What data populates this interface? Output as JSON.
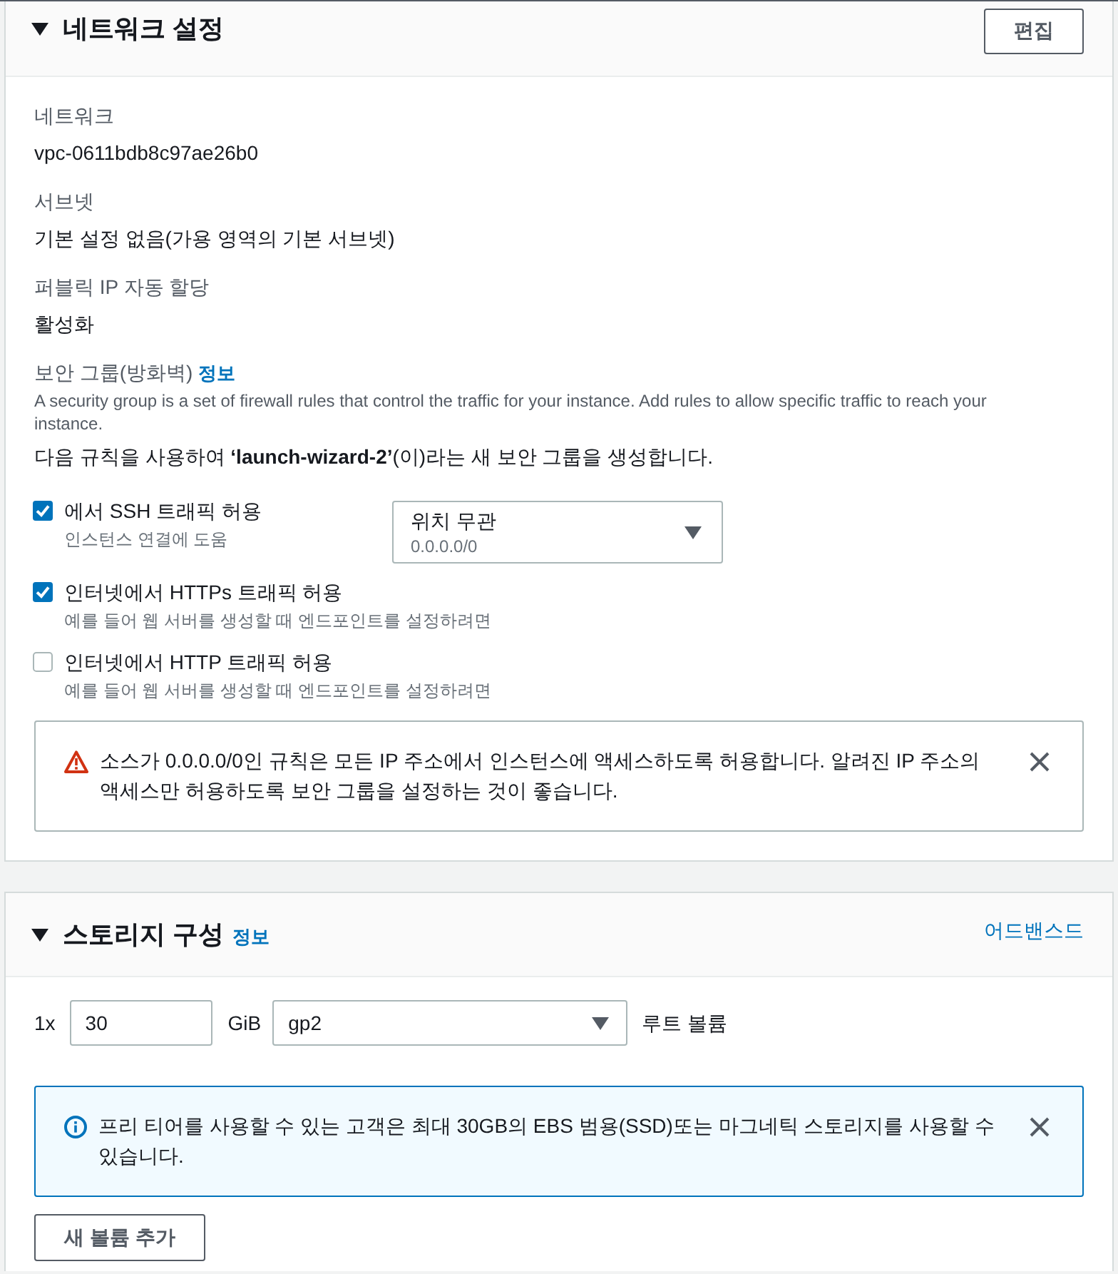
{
  "network_section": {
    "title": "네트워크 설정",
    "expanded": true,
    "edit_button": "편집",
    "fields": [
      {
        "label": "네트워크",
        "value": "vpc-0611bdb8c97ae26b0"
      },
      {
        "label": "서브넷",
        "value": "기본 설정 없음(가용 영역의 기본 서브넷)"
      },
      {
        "label": "퍼블릭 IP 자동 할당",
        "value": "활성화"
      }
    ],
    "security_group": {
      "label": "보안 그룹(방화벽)",
      "info_link": "정보",
      "description": "A security group is a set of firewall rules that control the traffic for your instance. Add rules to allow specific traffic to reach your instance.",
      "create_note": "다음 규칙을 사용하여 **‘launch-wizard-2’**(이)라는 새 보안 그룹을 생성합니다.",
      "rules": [
        {
          "label": "에서 SSH 트래픽 허용",
          "hint": "인스턴스 연결에 도움",
          "checked": true,
          "source_select": {
            "value": "위치 무관",
            "detail": "0.0.0.0/0"
          }
        },
        {
          "label": "인터넷에서 HTTPs 트래픽 허용",
          "hint": "예를 들어 웹 서버를 생성할 때 엔드포인트를 설정하려면",
          "checked": true
        },
        {
          "label": "인터넷에서 HTTP 트래픽 허용",
          "hint": "예를 들어 웹 서버를 생성할 때 엔드포인트를 설정하려면",
          "checked": false
        }
      ],
      "alert": {
        "kind": "warning",
        "text": "소스가 0.0.0.0/0인 규칙은 모든 IP 주소에서 인스턴스에 액세스하도록 허용합니다. 알려진 IP 주소의 액세스만 허용하도록 보안 그룹을 설정하는 것이 좋습니다."
      }
    }
  },
  "storage_section": {
    "title": "스토리지 구성",
    "info_link": "정보",
    "expanded": true,
    "advanced_link": "어드밴스드",
    "volume": {
      "count": "1x",
      "size": "30",
      "unit": "GiB",
      "type": "gp2",
      "label": "루트 볼륨"
    },
    "alert": {
      "kind": "info",
      "text": "프리 티어를 사용할 수 있는 고객은 최대 30GB의 EBS 범용(SSD)또는 마그네틱 스토리지를 사용할 수 있습니다."
    },
    "add_button": "새 볼륨 추가"
  }
}
